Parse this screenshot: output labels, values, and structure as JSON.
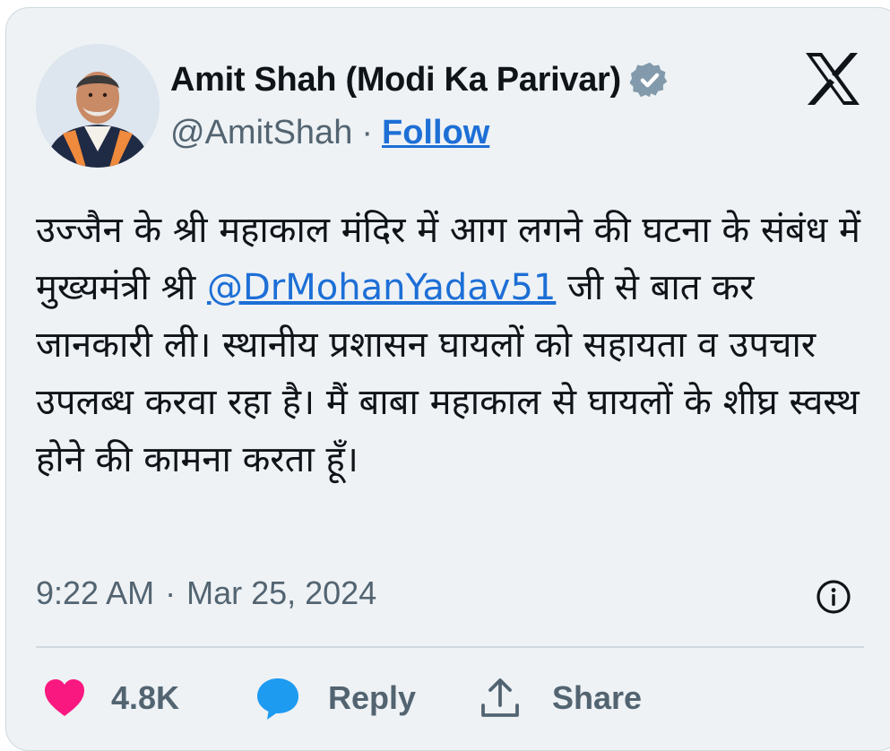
{
  "author": {
    "name": "Amit Shah (Modi Ka Parivar)",
    "handle": "@AmitShah",
    "separator": "·",
    "follow_label": "Follow",
    "avatar_icon": "avatar-photo",
    "verified_icon": "verified-badge-icon",
    "verified_color": "#829aab"
  },
  "brand": {
    "logo_icon": "x-logo-icon"
  },
  "tweet": {
    "text_before": "उज्जैन के श्री महाकाल मंदिर में आग लगने की घटना के संबंध में मुख्यमंत्री श्री ",
    "mention": "@DrMohanYadav51",
    "text_after": " जी से बात कर जानकारी ली। स्थानीय प्रशासन घायलों को सहायता व उपचार उपलब्ध करवा रहा है। मैं बाबा महाकाल से घायलों के शीघ्र स्वस्थ होने की कामना करता हूँ।"
  },
  "meta": {
    "time": "9:22 AM",
    "separator": "·",
    "date": "Mar 25, 2024",
    "info_icon": "info-icon"
  },
  "actions": {
    "like": {
      "icon": "heart-icon",
      "label": "4.8K",
      "color": "#f91880"
    },
    "reply": {
      "icon": "speech-bubble-icon",
      "label": "Reply",
      "color": "#1d9bf0"
    },
    "share": {
      "icon": "share-upload-icon",
      "label": "Share"
    }
  },
  "colors": {
    "card_bg": "#eef2f5",
    "link": "#1d6fd6",
    "muted": "#536471"
  }
}
